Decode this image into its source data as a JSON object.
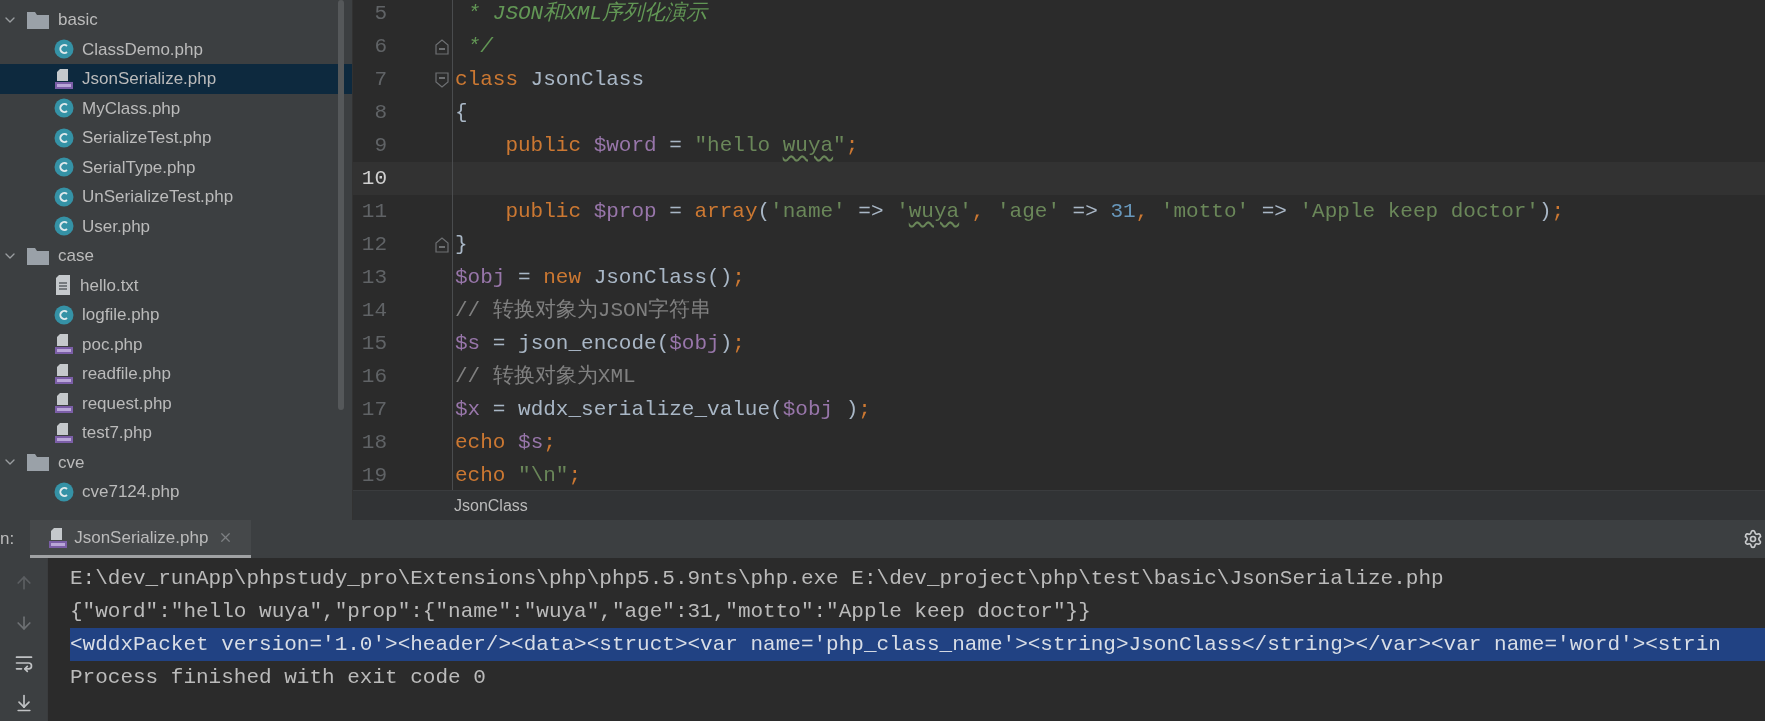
{
  "project_tree": {
    "items": [
      {
        "name": "basic",
        "kind": "folder",
        "expanded": true,
        "selected": false,
        "children": [
          {
            "name": "ClassDemo.php",
            "kind": "class",
            "selected": false
          },
          {
            "name": "JsonSerialize.php",
            "kind": "php",
            "selected": true
          },
          {
            "name": "MyClass.php",
            "kind": "class",
            "selected": false
          },
          {
            "name": "SerializeTest.php",
            "kind": "class",
            "selected": false
          },
          {
            "name": "SerialType.php",
            "kind": "class",
            "selected": false
          },
          {
            "name": "UnSerializeTest.php",
            "kind": "class",
            "selected": false
          },
          {
            "name": "User.php",
            "kind": "class",
            "selected": false
          }
        ]
      },
      {
        "name": "case",
        "kind": "folder",
        "expanded": true,
        "selected": false,
        "children": [
          {
            "name": "hello.txt",
            "kind": "text",
            "selected": false
          },
          {
            "name": "logfile.php",
            "kind": "class",
            "selected": false
          },
          {
            "name": "poc.php",
            "kind": "php",
            "selected": false
          },
          {
            "name": "readfile.php",
            "kind": "php",
            "selected": false
          },
          {
            "name": "request.php",
            "kind": "php",
            "selected": false
          },
          {
            "name": "test7.php",
            "kind": "php",
            "selected": false
          }
        ]
      },
      {
        "name": "cve",
        "kind": "folder",
        "expanded": true,
        "selected": false,
        "children": [
          {
            "name": "cve7124.php",
            "kind": "class",
            "selected": false
          }
        ]
      }
    ]
  },
  "editor": {
    "lines": [
      {
        "number": "5",
        "current": false,
        "tokens": [
          {
            "kind": "doc",
            "t": " * JSON和XML序列化演示"
          }
        ]
      },
      {
        "number": "6",
        "current": false,
        "fold": {
          "kind": "end"
        },
        "tokens": [
          {
            "kind": "doc",
            "t": " */"
          }
        ]
      },
      {
        "number": "7",
        "current": false,
        "fold": {
          "kind": "start"
        },
        "tokens": [
          {
            "kind": "kw",
            "t": "class"
          },
          {
            "kind": "plain",
            "t": " JsonClass"
          }
        ]
      },
      {
        "number": "8",
        "current": false,
        "tokens": [
          {
            "kind": "plain",
            "t": "{"
          }
        ]
      },
      {
        "number": "9",
        "current": false,
        "tokens": [
          {
            "kind": "kw",
            "t": "    public"
          },
          {
            "kind": "var",
            "t": " $word"
          },
          {
            "kind": "plain",
            "t": " = "
          },
          {
            "kind": "str",
            "t": "\"hello "
          },
          {
            "kind": "typo",
            "t": "wuya"
          },
          {
            "kind": "str",
            "t": "\""
          },
          {
            "kind": "punc",
            "t": ";"
          }
        ]
      },
      {
        "number": "10",
        "current": true
      },
      {
        "number": "11",
        "current": false,
        "tokens": [
          {
            "kind": "kw",
            "t": "    public"
          },
          {
            "kind": "var",
            "t": " $prop"
          },
          {
            "kind": "plain",
            "t": " = "
          },
          {
            "kind": "kw",
            "t": "array"
          },
          {
            "kind": "plain",
            "t": "("
          },
          {
            "kind": "str",
            "t": "'name'"
          },
          {
            "kind": "plain",
            "t": " => "
          },
          {
            "kind": "str",
            "t": "'"
          },
          {
            "kind": "typo",
            "t": "wuya"
          },
          {
            "kind": "str",
            "t": "'"
          },
          {
            "kind": "punc",
            "t": ","
          },
          {
            "kind": "str",
            "t": " 'age'"
          },
          {
            "kind": "plain",
            "t": " => "
          },
          {
            "kind": "num",
            "t": "31"
          },
          {
            "kind": "punc",
            "t": ","
          },
          {
            "kind": "str",
            "t": " 'motto'"
          },
          {
            "kind": "plain",
            "t": " => "
          },
          {
            "kind": "str",
            "t": "'Apple keep doctor'"
          },
          {
            "kind": "plain",
            "t": ")"
          },
          {
            "kind": "punc",
            "t": ";"
          }
        ]
      },
      {
        "number": "12",
        "current": false,
        "fold": {
          "kind": "end"
        },
        "tokens": [
          {
            "kind": "plain",
            "t": "}"
          }
        ]
      },
      {
        "number": "13",
        "current": false,
        "tokens": [
          {
            "kind": "var",
            "t": "$obj"
          },
          {
            "kind": "plain",
            "t": " = "
          },
          {
            "kind": "kw",
            "t": "new"
          },
          {
            "kind": "plain",
            "t": " JsonClass()"
          },
          {
            "kind": "punc",
            "t": ";"
          }
        ]
      },
      {
        "number": "14",
        "current": false,
        "tokens": [
          {
            "kind": "cmt",
            "t": "// 转换对象为JSON字符串"
          }
        ]
      },
      {
        "number": "15",
        "current": false,
        "tokens": [
          {
            "kind": "var",
            "t": "$s"
          },
          {
            "kind": "plain",
            "t": " = json_encode("
          },
          {
            "kind": "var",
            "t": "$obj"
          },
          {
            "kind": "plain",
            "t": ")"
          },
          {
            "kind": "punc",
            "t": ";"
          }
        ]
      },
      {
        "number": "16",
        "current": false,
        "tokens": [
          {
            "kind": "cmt",
            "t": "// 转换对象为XML"
          }
        ]
      },
      {
        "number": "17",
        "current": false,
        "tokens": [
          {
            "kind": "var",
            "t": "$x"
          },
          {
            "kind": "plain",
            "t": " = wddx_serialize_value("
          },
          {
            "kind": "var",
            "t": "$obj"
          },
          {
            "kind": "plain",
            "t": " )"
          },
          {
            "kind": "punc",
            "t": ";"
          }
        ]
      },
      {
        "number": "18",
        "current": false,
        "tokens": [
          {
            "kind": "kw",
            "t": "echo"
          },
          {
            "kind": "var",
            "t": " $s"
          },
          {
            "kind": "punc",
            "t": ";"
          }
        ]
      },
      {
        "number": "19",
        "current": false,
        "tokens": [
          {
            "kind": "kw",
            "t": "echo"
          },
          {
            "kind": "str",
            "t": " \"\\n\""
          },
          {
            "kind": "punc",
            "t": ";"
          }
        ]
      }
    ],
    "breadcrumb": "JsonClass"
  },
  "run_panel": {
    "label": "n:",
    "tabs": [
      {
        "label": "JsonSerialize.php",
        "selected": true
      }
    ],
    "output": [
      {
        "text": "E:\\dev_runApp\\phpstudy_pro\\Extensions\\php\\php5.5.9nts\\php.exe E:\\dev_project\\php\\test\\basic\\JsonSerialize.php",
        "selected": false
      },
      {
        "text": "{\"word\":\"hello wuya\",\"prop\":{\"name\":\"wuya\",\"age\":31,\"motto\":\"Apple keep doctor\"}}",
        "selected": false
      },
      {
        "text": "<wddxPacket version='1.0'><header/><data><struct><var name='php_class_name'><string>JsonClass</string></var><var name='word'><strin",
        "selected": true
      },
      {
        "text": "Process finished with exit code 0",
        "selected": false
      }
    ]
  }
}
